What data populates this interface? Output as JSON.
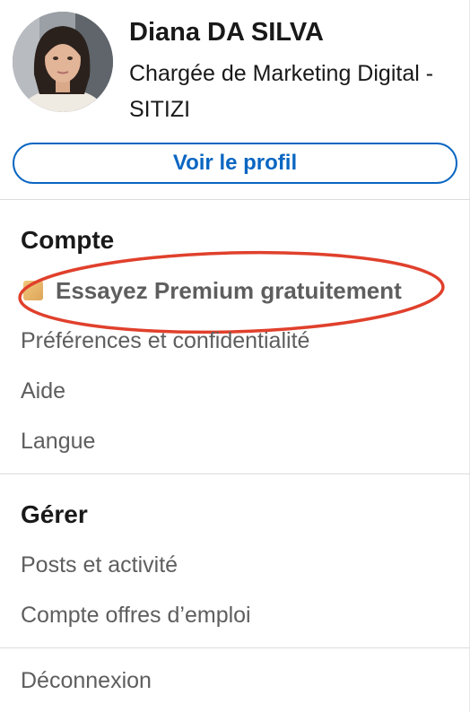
{
  "profile": {
    "name": "Diana DA SILVA",
    "headline": "Chargée de Marketing Digital - SITIZI",
    "view_profile_label": "Voir le profil"
  },
  "account": {
    "title": "Compte",
    "premium_label": "Essayez Premium gratuitement",
    "premium_icon": "premium-badge-icon",
    "items": [
      "Préférences et confidentialité",
      "Aide",
      "Langue"
    ]
  },
  "manage": {
    "title": "Gérer",
    "items": [
      "Posts et activité",
      "Compte offres d’emploi"
    ]
  },
  "sign_out_label": "Déconnexion",
  "colors": {
    "link_blue": "#0a66c2",
    "annotation_red": "#e0402c",
    "premium_gold": "#dea55a",
    "muted_text": "#5e5e5e"
  }
}
